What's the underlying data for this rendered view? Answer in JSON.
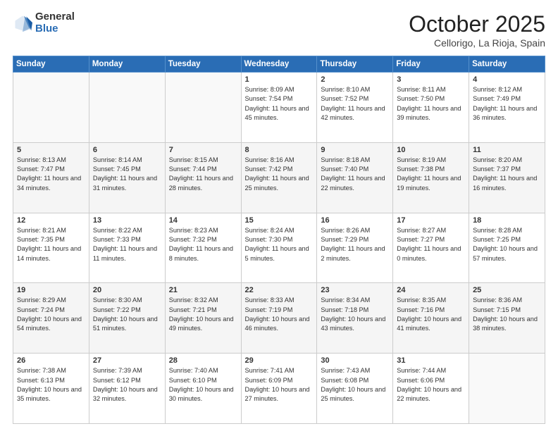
{
  "header": {
    "logo_general": "General",
    "logo_blue": "Blue",
    "month": "October 2025",
    "location": "Cellorigo, La Rioja, Spain"
  },
  "days_of_week": [
    "Sunday",
    "Monday",
    "Tuesday",
    "Wednesday",
    "Thursday",
    "Friday",
    "Saturday"
  ],
  "weeks": [
    [
      {
        "day": "",
        "sunrise": "",
        "sunset": "",
        "daylight": ""
      },
      {
        "day": "",
        "sunrise": "",
        "sunset": "",
        "daylight": ""
      },
      {
        "day": "",
        "sunrise": "",
        "sunset": "",
        "daylight": ""
      },
      {
        "day": "1",
        "sunrise": "Sunrise: 8:09 AM",
        "sunset": "Sunset: 7:54 PM",
        "daylight": "Daylight: 11 hours and 45 minutes."
      },
      {
        "day": "2",
        "sunrise": "Sunrise: 8:10 AM",
        "sunset": "Sunset: 7:52 PM",
        "daylight": "Daylight: 11 hours and 42 minutes."
      },
      {
        "day": "3",
        "sunrise": "Sunrise: 8:11 AM",
        "sunset": "Sunset: 7:50 PM",
        "daylight": "Daylight: 11 hours and 39 minutes."
      },
      {
        "day": "4",
        "sunrise": "Sunrise: 8:12 AM",
        "sunset": "Sunset: 7:49 PM",
        "daylight": "Daylight: 11 hours and 36 minutes."
      }
    ],
    [
      {
        "day": "5",
        "sunrise": "Sunrise: 8:13 AM",
        "sunset": "Sunset: 7:47 PM",
        "daylight": "Daylight: 11 hours and 34 minutes."
      },
      {
        "day": "6",
        "sunrise": "Sunrise: 8:14 AM",
        "sunset": "Sunset: 7:45 PM",
        "daylight": "Daylight: 11 hours and 31 minutes."
      },
      {
        "day": "7",
        "sunrise": "Sunrise: 8:15 AM",
        "sunset": "Sunset: 7:44 PM",
        "daylight": "Daylight: 11 hours and 28 minutes."
      },
      {
        "day": "8",
        "sunrise": "Sunrise: 8:16 AM",
        "sunset": "Sunset: 7:42 PM",
        "daylight": "Daylight: 11 hours and 25 minutes."
      },
      {
        "day": "9",
        "sunrise": "Sunrise: 8:18 AM",
        "sunset": "Sunset: 7:40 PM",
        "daylight": "Daylight: 11 hours and 22 minutes."
      },
      {
        "day": "10",
        "sunrise": "Sunrise: 8:19 AM",
        "sunset": "Sunset: 7:38 PM",
        "daylight": "Daylight: 11 hours and 19 minutes."
      },
      {
        "day": "11",
        "sunrise": "Sunrise: 8:20 AM",
        "sunset": "Sunset: 7:37 PM",
        "daylight": "Daylight: 11 hours and 16 minutes."
      }
    ],
    [
      {
        "day": "12",
        "sunrise": "Sunrise: 8:21 AM",
        "sunset": "Sunset: 7:35 PM",
        "daylight": "Daylight: 11 hours and 14 minutes."
      },
      {
        "day": "13",
        "sunrise": "Sunrise: 8:22 AM",
        "sunset": "Sunset: 7:33 PM",
        "daylight": "Daylight: 11 hours and 11 minutes."
      },
      {
        "day": "14",
        "sunrise": "Sunrise: 8:23 AM",
        "sunset": "Sunset: 7:32 PM",
        "daylight": "Daylight: 11 hours and 8 minutes."
      },
      {
        "day": "15",
        "sunrise": "Sunrise: 8:24 AM",
        "sunset": "Sunset: 7:30 PM",
        "daylight": "Daylight: 11 hours and 5 minutes."
      },
      {
        "day": "16",
        "sunrise": "Sunrise: 8:26 AM",
        "sunset": "Sunset: 7:29 PM",
        "daylight": "Daylight: 11 hours and 2 minutes."
      },
      {
        "day": "17",
        "sunrise": "Sunrise: 8:27 AM",
        "sunset": "Sunset: 7:27 PM",
        "daylight": "Daylight: 11 hours and 0 minutes."
      },
      {
        "day": "18",
        "sunrise": "Sunrise: 8:28 AM",
        "sunset": "Sunset: 7:25 PM",
        "daylight": "Daylight: 10 hours and 57 minutes."
      }
    ],
    [
      {
        "day": "19",
        "sunrise": "Sunrise: 8:29 AM",
        "sunset": "Sunset: 7:24 PM",
        "daylight": "Daylight: 10 hours and 54 minutes."
      },
      {
        "day": "20",
        "sunrise": "Sunrise: 8:30 AM",
        "sunset": "Sunset: 7:22 PM",
        "daylight": "Daylight: 10 hours and 51 minutes."
      },
      {
        "day": "21",
        "sunrise": "Sunrise: 8:32 AM",
        "sunset": "Sunset: 7:21 PM",
        "daylight": "Daylight: 10 hours and 49 minutes."
      },
      {
        "day": "22",
        "sunrise": "Sunrise: 8:33 AM",
        "sunset": "Sunset: 7:19 PM",
        "daylight": "Daylight: 10 hours and 46 minutes."
      },
      {
        "day": "23",
        "sunrise": "Sunrise: 8:34 AM",
        "sunset": "Sunset: 7:18 PM",
        "daylight": "Daylight: 10 hours and 43 minutes."
      },
      {
        "day": "24",
        "sunrise": "Sunrise: 8:35 AM",
        "sunset": "Sunset: 7:16 PM",
        "daylight": "Daylight: 10 hours and 41 minutes."
      },
      {
        "day": "25",
        "sunrise": "Sunrise: 8:36 AM",
        "sunset": "Sunset: 7:15 PM",
        "daylight": "Daylight: 10 hours and 38 minutes."
      }
    ],
    [
      {
        "day": "26",
        "sunrise": "Sunrise: 7:38 AM",
        "sunset": "Sunset: 6:13 PM",
        "daylight": "Daylight: 10 hours and 35 minutes."
      },
      {
        "day": "27",
        "sunrise": "Sunrise: 7:39 AM",
        "sunset": "Sunset: 6:12 PM",
        "daylight": "Daylight: 10 hours and 32 minutes."
      },
      {
        "day": "28",
        "sunrise": "Sunrise: 7:40 AM",
        "sunset": "Sunset: 6:10 PM",
        "daylight": "Daylight: 10 hours and 30 minutes."
      },
      {
        "day": "29",
        "sunrise": "Sunrise: 7:41 AM",
        "sunset": "Sunset: 6:09 PM",
        "daylight": "Daylight: 10 hours and 27 minutes."
      },
      {
        "day": "30",
        "sunrise": "Sunrise: 7:43 AM",
        "sunset": "Sunset: 6:08 PM",
        "daylight": "Daylight: 10 hours and 25 minutes."
      },
      {
        "day": "31",
        "sunrise": "Sunrise: 7:44 AM",
        "sunset": "Sunset: 6:06 PM",
        "daylight": "Daylight: 10 hours and 22 minutes."
      },
      {
        "day": "",
        "sunrise": "",
        "sunset": "",
        "daylight": ""
      }
    ]
  ]
}
